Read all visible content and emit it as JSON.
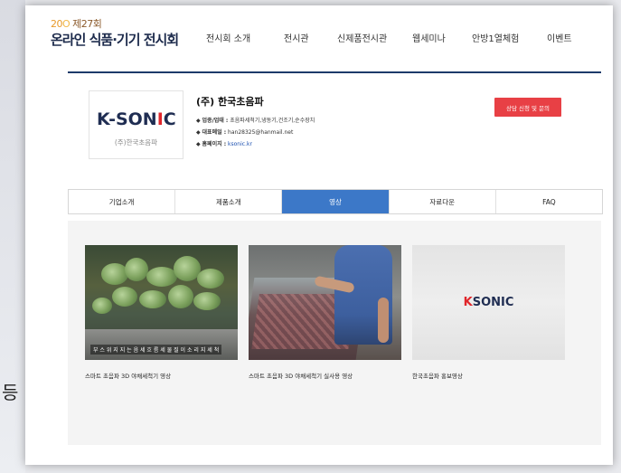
{
  "header": {
    "logo_year": "20",
    "logo_year_mid": "O",
    "logo_edition": "제27회",
    "logo_title": "온라인 식품·기기 전시회",
    "nav": [
      "전시회 소개",
      "전시관",
      "신제품전시관",
      "웹세미나",
      "안방1열체험",
      "이벤트"
    ]
  },
  "company": {
    "logo_brand_left": "K-SON",
    "logo_brand_i": "I",
    "logo_brand_right": "C",
    "logo_sub": "(주)한국초음파",
    "name": "(주) 한국초음파",
    "info": [
      {
        "key": "업종/업태 :",
        "value": "초음파세척기,냉동기,건조기,순수장치"
      },
      {
        "key": "대표메일 :",
        "value": "han28325@hanmail.net"
      },
      {
        "key": "홈페이지 :",
        "value": "ksonic.kr"
      }
    ],
    "inquiry_button": "상담 신청 및 문의"
  },
  "tabs": [
    {
      "label": "기업소개",
      "active": false
    },
    {
      "label": "제품소개",
      "active": false
    },
    {
      "label": "영상",
      "active": true
    },
    {
      "label": "자료다운",
      "active": false
    },
    {
      "label": "FAQ",
      "active": false
    }
  ],
  "videos": [
    {
      "thumb_subtitle": "부 스 위 지 지 는 음 세 흐 름 세 물 질 이 소 리 지 세 척",
      "caption": "스마트 초음파 3D 야채세척기 영상"
    },
    {
      "caption": "스마트 초음파 3D 야채세척기 실사용 영상"
    },
    {
      "thumb_logo_left": "K",
      "thumb_logo_right": "SONIC",
      "caption": "한국초음파 홍보영상"
    }
  ],
  "side_char": "등",
  "colors": {
    "accent_blue": "#3c78c8",
    "brand_navy": "#1d3b6a",
    "inquiry_red": "#e84045",
    "brand_red": "#e0262b"
  }
}
